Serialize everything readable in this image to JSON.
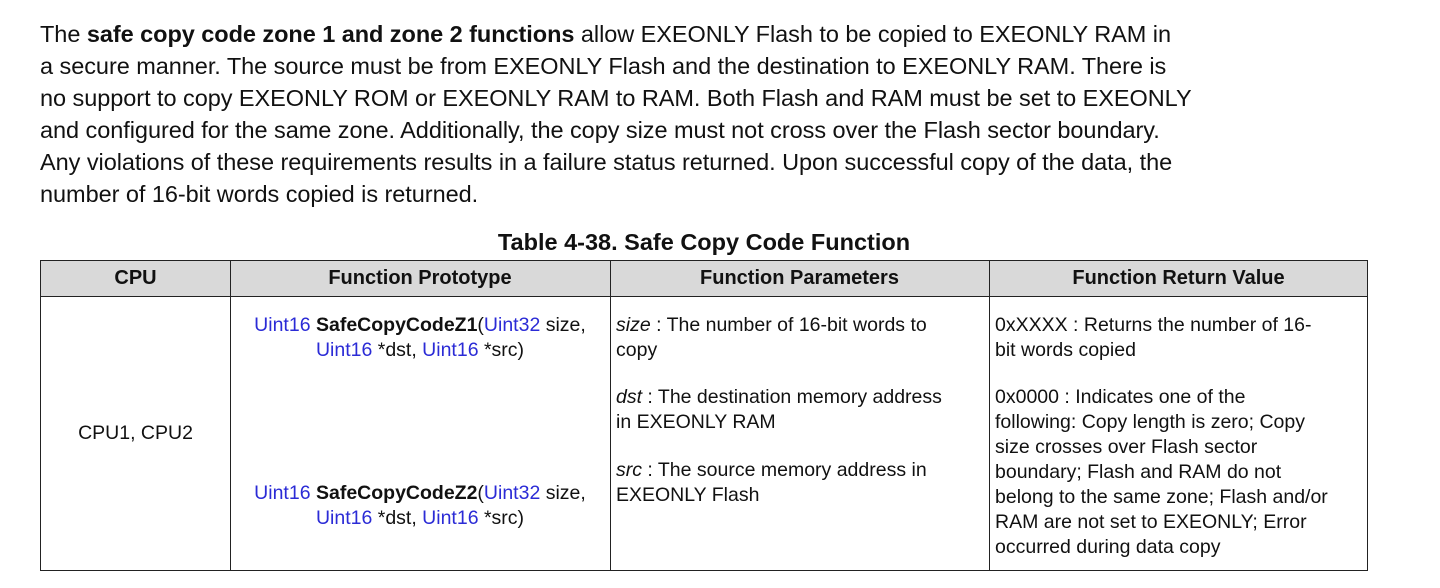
{
  "paragraph": {
    "line1_pre": "The ",
    "line1_bold": "safe copy code zone 1 and zone 2 functions",
    "line1_post": " allow EXEONLY Flash to be copied to EXEONLY RAM in",
    "line2": "a secure manner. The source must be from EXEONLY Flash and the destination to EXEONLY RAM. There is",
    "line3": "no support to copy EXEONLY ROM or EXEONLY RAM to RAM. Both Flash and RAM must be set to EXEONLY",
    "line4": "and configured for the same zone. Additionally, the copy size must not cross over the Flash sector boundary.",
    "line5": "Any violations of these requirements results in a failure status returned. Upon successful copy of the data, the",
    "line6": "number of 16-bit words copied is returned."
  },
  "table": {
    "title": "Table 4-38. Safe Copy Code Function",
    "headers": {
      "cpu": "CPU",
      "prototype": "Function Prototype",
      "parameters": "Function Parameters",
      "return_value": "Function Return Value"
    },
    "cpu": "CPU1, CPU2",
    "prototypes": [
      {
        "ret_type": "Uint16",
        "name": "SafeCopyCodeZ1",
        "paren_open": "(",
        "arg1_type": "Uint32",
        "arg1_rest": " size,",
        "arg2_type": "Uint16",
        "arg2_rest": " *dst, ",
        "arg3_type": "Uint16",
        "arg3_rest": " *src)"
      },
      {
        "ret_type": "Uint16",
        "name": "SafeCopyCodeZ2",
        "paren_open": "(",
        "arg1_type": "Uint32",
        "arg1_rest": " size,",
        "arg2_type": "Uint16",
        "arg2_rest": " *dst, ",
        "arg3_type": "Uint16",
        "arg3_rest": " *src)"
      }
    ],
    "parameters": [
      {
        "name": "size",
        "line1": " : The number of 16-bit words to",
        "line2": "copy"
      },
      {
        "name": "dst",
        "line1": " : The destination memory address",
        "line2": "in EXEONLY RAM"
      },
      {
        "name": "src",
        "line1": " : The source memory address in",
        "line2": "EXEONLY Flash"
      }
    ],
    "return_values": [
      {
        "lines": [
          "0xXXXX : Returns the number of 16-",
          "bit words copied"
        ]
      },
      {
        "lines": [
          "0x0000 : Indicates one of the",
          "following: Copy length is zero; Copy",
          "size crosses over Flash sector",
          "boundary; Flash and RAM do not",
          "belong to the same zone; Flash and/or",
          "RAM are not set to EXEONLY; Error",
          "occurred during data copy"
        ]
      }
    ],
    "colors": {
      "type_blue": "#2b2bd6",
      "header_bg": "#d9d9d9",
      "border": "#222222"
    }
  }
}
